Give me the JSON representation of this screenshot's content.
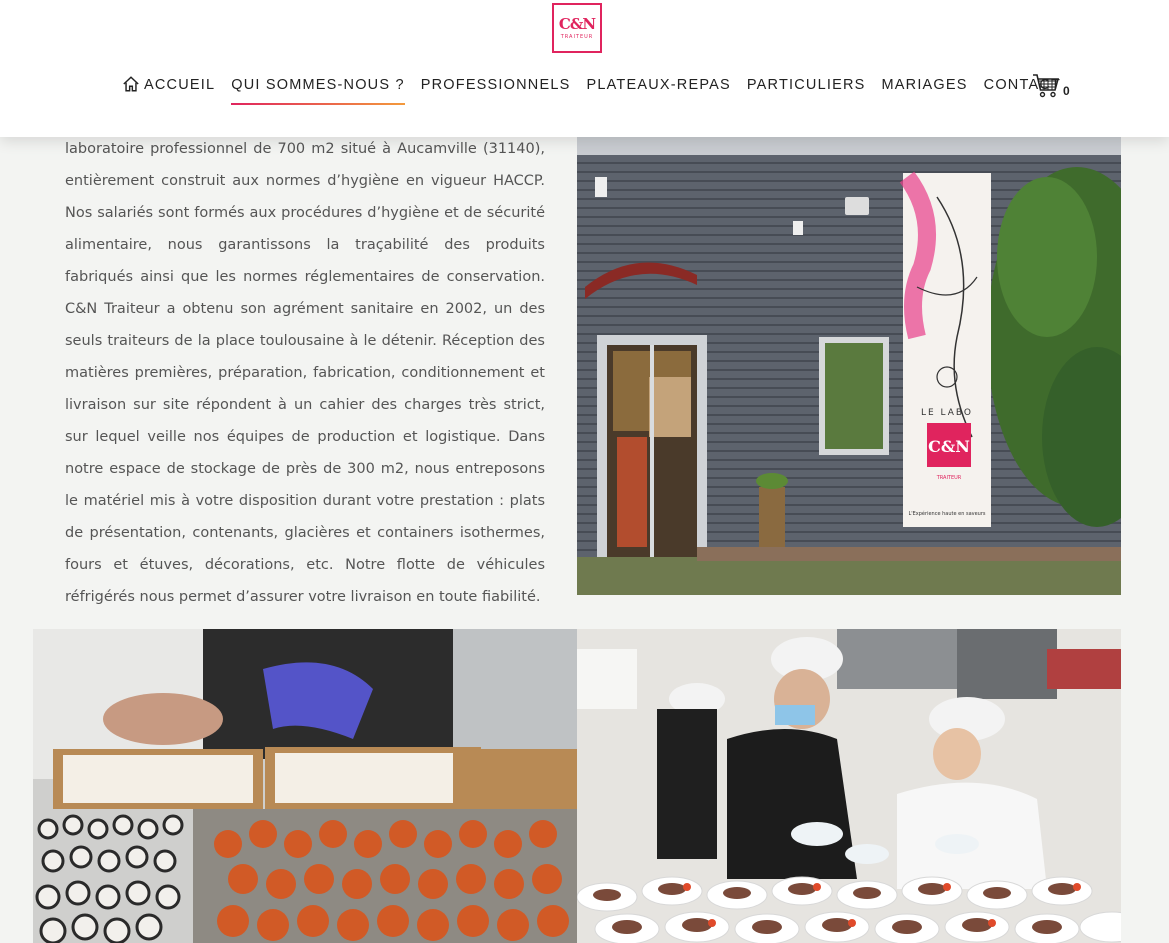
{
  "header": {
    "logo": {
      "text": "C&N",
      "subtext": "TRAITEUR"
    },
    "nav": [
      {
        "label": "ACCUEIL",
        "icon": "home-icon",
        "active": false
      },
      {
        "label": "QUI SOMMES-NOUS ?",
        "active": true
      },
      {
        "label": "PROFESSIONNELS",
        "active": false
      },
      {
        "label": "PLATEAUX-REPAS",
        "active": false
      },
      {
        "label": "PARTICULIERS",
        "active": false
      },
      {
        "label": "MARIAGES",
        "active": false
      },
      {
        "label": "CONTACT",
        "active": false
      }
    ],
    "cart": {
      "icon": "cart-icon",
      "count": "0"
    }
  },
  "main": {
    "paragraph": "laboratoire professionnel de 700 m2 situé à Aucamville (31140), entièrement construit aux normes d’hygiène en vigueur HACCP. Nos salariés sont formés aux procédures d’hygiène et de sécurité alimentaire, nous garantissons la traçabilité des produits fabriqués ainsi que les normes réglementaires de conservation. C&N Traiteur a obtenu son agrément sanitaire en 2002, un des seuls traiteurs de la place toulousaine à le détenir. Réception des matières premières, préparation, fabrication, conditionnement et livraison sur site répondent à un cahier des charges très strict, sur lequel veille nos équipes de production et logistique. Dans notre espace de stockage de près de 300 m2, nous entreposons le matériel mis à votre disposition durant votre prestation : plats de présentation, contenants, glacières et containers isothermes, fours et étuves, décorations, etc. Notre flotte de véhicules réfrigérés nous permet d’assurer votre livraison en toute fiabilité.",
    "lab_sign": {
      "top": "LE LABO",
      "brand": "C&N",
      "sub": "TRAITEUR",
      "tagline": "L'Expérience haute en saveurs"
    }
  },
  "colors": {
    "brand": "#e0245e",
    "accent": "#f39a3c",
    "background": "#f3f4f2"
  }
}
